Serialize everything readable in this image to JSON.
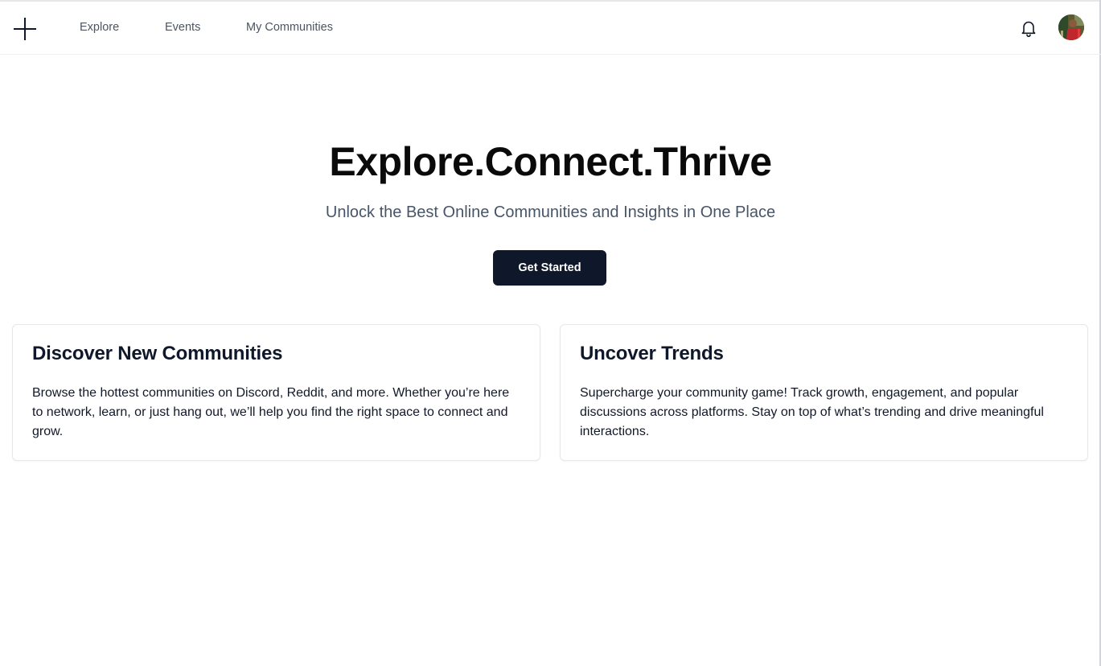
{
  "nav": {
    "logo_icon": "plus-icon",
    "links": [
      "Explore",
      "Events",
      "My Communities"
    ],
    "notification_icon": "bell-icon",
    "avatar_icon": "user-avatar"
  },
  "hero": {
    "title": "Explore.Connect.Thrive",
    "subtitle": "Unlock the Best Online Communities and Insights in One Place",
    "cta_label": "Get Started"
  },
  "cards": [
    {
      "title": "Discover New Communities",
      "body": "Browse the hottest communities on Discord, Reddit, and more. Whether you’re here to network, learn, or just hang out, we’ll help you find the right space to connect and grow."
    },
    {
      "title": "Uncover Trends",
      "body": "Supercharge your community game! Track growth, engagement, and popular discussions across platforms. Stay on top of what’s trending and drive meaningful interactions."
    }
  ],
  "colors": {
    "primary_button": "#0f172a",
    "nav_text": "#4b5563",
    "subtitle_text": "#475569",
    "card_border": "#e5e7eb"
  }
}
